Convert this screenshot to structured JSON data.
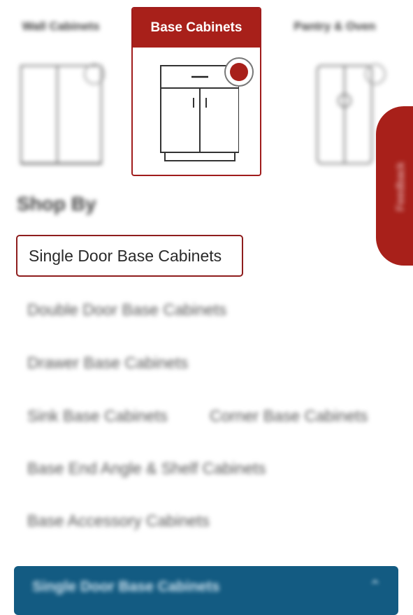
{
  "categories": {
    "left": {
      "title": "Wall Cabinets"
    },
    "selected": {
      "title": "Base Cabinets"
    },
    "right": {
      "title": "Pantry & Oven"
    }
  },
  "feedback": {
    "label": "Feedback"
  },
  "shop_by": {
    "heading": "Shop By"
  },
  "options": [
    {
      "label": "Single Door Base Cabinets",
      "selected": true
    },
    {
      "label": "Double Door Base Cabinets",
      "selected": false
    },
    {
      "label": "Drawer Base Cabinets",
      "selected": false
    },
    {
      "label": "Sink Base Cabinets",
      "selected": false
    },
    {
      "label": "Corner Base Cabinets",
      "selected": false
    },
    {
      "label": "Base End Angle & Shelf Cabinets",
      "selected": false
    },
    {
      "label": "Base Accessory Cabinets",
      "selected": false
    }
  ],
  "accordion": {
    "label": "Single Door Base Cabinets",
    "chevron": "chevron-up-icon"
  },
  "colors": {
    "brand_red": "#a8201a",
    "selected_border": "#8e1d1d",
    "blue_bar": "#135b82"
  }
}
